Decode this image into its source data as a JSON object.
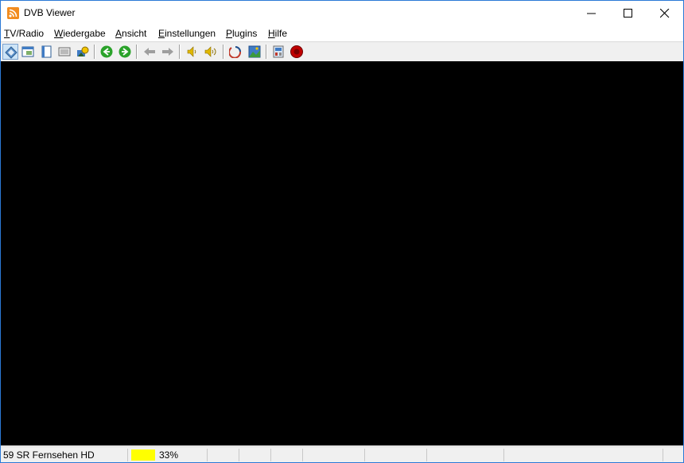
{
  "window": {
    "title": "DVB Viewer"
  },
  "menu": {
    "items": [
      {
        "accel": "T",
        "rest": "V/Radio"
      },
      {
        "accel": "W",
        "rest": "iedergabe"
      },
      {
        "accel": "A",
        "rest": "nsicht"
      },
      {
        "accel": "E",
        "rest": "instellungen"
      },
      {
        "accel": "P",
        "rest": "lugins"
      },
      {
        "accel": "H",
        "rest": "ilfe"
      }
    ]
  },
  "toolbar": {
    "buttons": [
      {
        "icon": "channel-list-icon",
        "pressed": true
      },
      {
        "icon": "window-mode-icon"
      },
      {
        "icon": "fullscreen-icon"
      },
      {
        "icon": "desktop-mode-icon"
      },
      {
        "icon": "epg-icon"
      },
      {
        "icon": "back-icon",
        "color": "#2aa22a"
      },
      {
        "icon": "forward-icon",
        "color": "#2aa22a"
      },
      {
        "icon": "previous-channel-icon"
      },
      {
        "icon": "next-channel-icon"
      },
      {
        "icon": "volume-down-icon",
        "color": "#e0b800"
      },
      {
        "icon": "volume-up-icon",
        "color": "#e0b800"
      },
      {
        "icon": "teletext-icon"
      },
      {
        "icon": "snapshot-icon"
      },
      {
        "icon": "recorder-icon"
      },
      {
        "icon": "record-icon",
        "color": "#c00000"
      }
    ]
  },
  "status": {
    "channel": "59 SR Fernsehen HD",
    "signal_percent": "33%",
    "signal_level": 0.33,
    "meter_color": "#ffff00"
  }
}
